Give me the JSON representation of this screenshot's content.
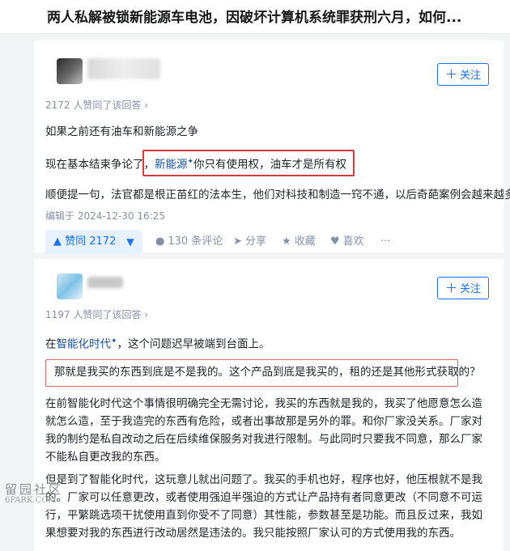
{
  "page": {
    "title": "两人私解被锁新能源车电池，因破坏计算机系统罪获刑六月，如何..."
  },
  "answer1": {
    "follow_label": "关注",
    "votes_meta": "2172 人赞同了该回答 ›",
    "p1": "如果之前还有油车和新能源之争",
    "p2_prefix": "现在基本结束争论了，",
    "p2_link": "新能源",
    "p2_suffix": "你只有使用权，油车才是所有权",
    "p3": "顺便提一句，法官都是根正苗红的法本生，他们对科技和制造一窍不通，以后奇葩案例会越来越多",
    "edited": "编辑于 2024-12-30 16:25",
    "vote_up_label": "▲ 赞同 2172",
    "vote_down_label": "▼",
    "comments_label": "130 条评论",
    "share_label": "分享",
    "favorite_label": "收藏",
    "like_label": "喜欢",
    "more_label": "···"
  },
  "answer2": {
    "follow_label": "关注",
    "votes_meta": "1197 人赞同了该回答 ›",
    "p1_prefix": "在",
    "p1_link": "智能化时代",
    "p1_suffix": "，这个问题迟早被端到台面上。",
    "quote": "那就是我买的东西到底是不是我的。这个产品到底是我买的，租的还是其他形式获取的？",
    "p2": "在前智能化时代这个事情很明确完全无需讨论，我买的东西就是我的，我买了他愿意怎么造就怎么造，至于我造完的东西有危险，或者出事故那是另外的罪。和你厂家没关系。厂家对我的制约是私自改动之后在后续维保服务对我进行限制。与此同时只要我不同意，那么厂家不能私自更改我的东西。",
    "p3": "但是到了智能化时代，这玩意儿就出问题了。我买的手机也好，程序也好，他压根就不是我的。厂家可以任意更改，或者使用强迫半强迫的方式让产品持有者同意更改（不同意不可运行，平繁跳选项干扰使用直到你受不了同意）其性能，参数甚至是功能。而且反过来，我如果想要对我的东西进行改动居然是违法的。我只能按照厂家认可的方式使用我的东西。"
  },
  "watermark": {
    "line1": "留园社区",
    "line2": "6PARK.COM"
  },
  "colors": {
    "accent": "#1772f6",
    "link": "#175199",
    "highlight": "#d9393c",
    "meta": "#8590a6"
  }
}
